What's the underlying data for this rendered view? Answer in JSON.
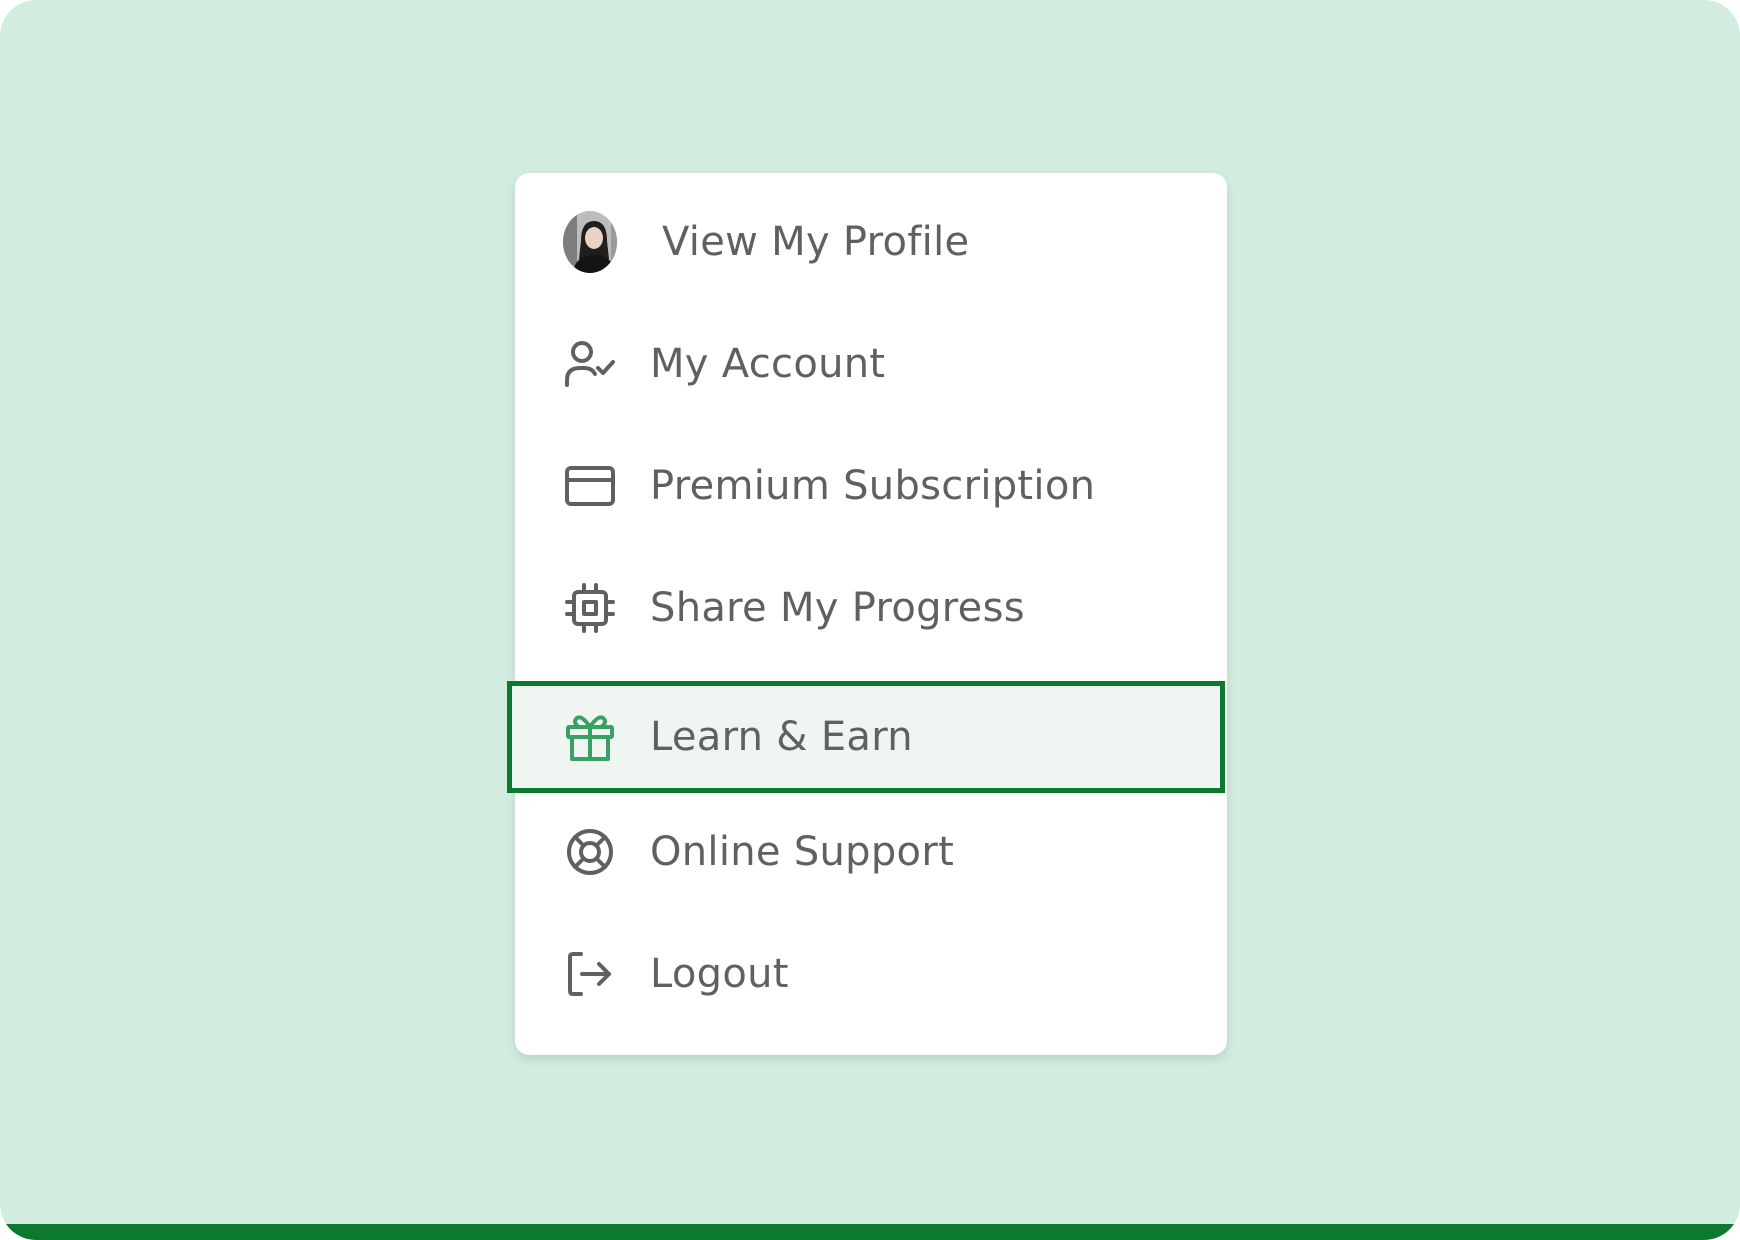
{
  "menu": {
    "items": [
      {
        "label": "View My Profile",
        "icon": "avatar"
      },
      {
        "label": "My Account",
        "icon": "user-check-icon"
      },
      {
        "label": "Premium Subscription",
        "icon": "credit-card-icon"
      },
      {
        "label": "Share My Progress",
        "icon": "chip-icon"
      },
      {
        "label": "Learn & Earn",
        "icon": "gift-icon",
        "active": true
      },
      {
        "label": "Online Support",
        "icon": "lifebuoy-icon"
      },
      {
        "label": "Logout",
        "icon": "logout-icon"
      }
    ]
  },
  "colors": {
    "background": "#d2ede0",
    "accent": "#0b7a2f",
    "gift_icon": "#3aa064",
    "text": "#5f6064"
  }
}
